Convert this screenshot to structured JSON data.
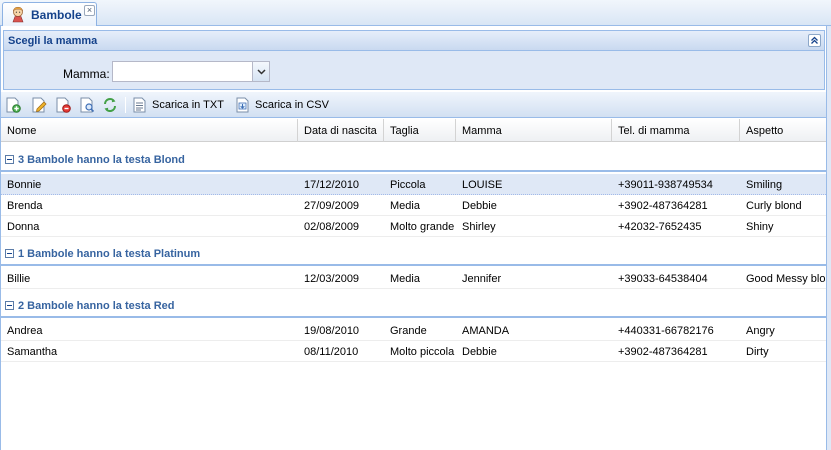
{
  "tab": {
    "label": "Bambole",
    "close": "×"
  },
  "form": {
    "title": "Scegli la mamma",
    "mamma_label": "Mamma:",
    "mamma_value": ""
  },
  "toolbar": {
    "buttons": [
      {
        "icon": "add-row-icon"
      },
      {
        "icon": "edit-row-icon"
      },
      {
        "icon": "delete-row-icon"
      },
      {
        "icon": "view-row-icon"
      },
      {
        "icon": "refresh-icon"
      }
    ],
    "download_txt": "Scarica in TXT",
    "download_csv": "Scarica in CSV"
  },
  "grid": {
    "columns": [
      "Nome",
      "Data di nascita",
      "Taglia",
      "Mamma",
      "Tel. di mamma",
      "Aspetto"
    ],
    "groups": [
      {
        "title": "3 Bambole hanno la testa Blond",
        "rows": [
          [
            "Bonnie",
            "17/12/2010",
            "Piccola",
            "LOUISE",
            "+39011-938749534",
            "Smiling"
          ],
          [
            "Brenda",
            "27/09/2009",
            "Media",
            "Debbie",
            "+3902-487364281",
            "Curly blond"
          ],
          [
            "Donna",
            "02/08/2009",
            "Molto grande",
            "Shirley",
            "+42032-7652435",
            "Shiny"
          ]
        ]
      },
      {
        "title": "1 Bambole hanno la testa Platinum",
        "rows": [
          [
            "Billie",
            "12/03/2009",
            "Media",
            "Jennifer",
            "+39033-64538404",
            "Good Messy blond"
          ]
        ]
      },
      {
        "title": "2 Bambole hanno la testa Red",
        "rows": [
          [
            "Andrea",
            "19/08/2010",
            "Grande",
            "AMANDA",
            "+440331-66782176",
            "Angry"
          ],
          [
            "Samantha",
            "08/11/2010",
            "Molto piccola",
            "Debbie",
            "+3902-487364281",
            "Dirty"
          ]
        ]
      }
    ]
  },
  "colors": {
    "accent": "#15428b",
    "group_text": "#3764a0",
    "border": "#99bbe8",
    "selected_row": "#dfe8f6"
  }
}
